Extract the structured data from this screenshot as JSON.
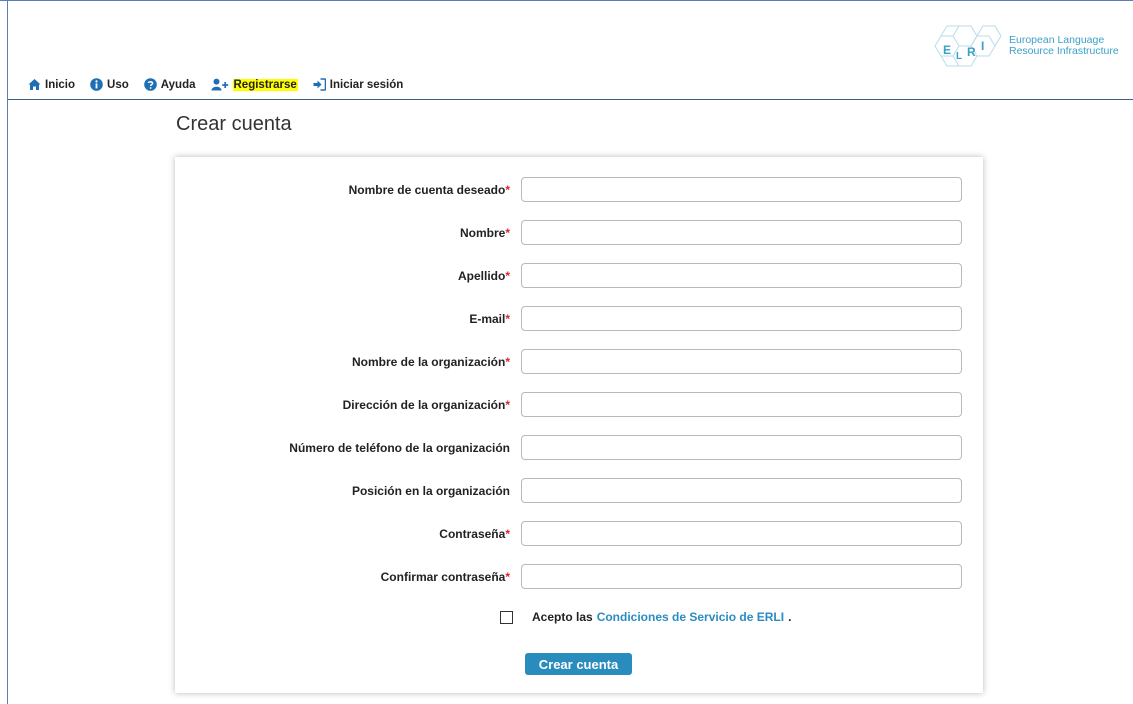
{
  "nav": {
    "items": [
      {
        "label": "Inicio",
        "icon": "home-icon"
      },
      {
        "label": "Uso",
        "icon": "info-icon"
      },
      {
        "label": "Ayuda",
        "icon": "help-icon"
      },
      {
        "label": "Registrarse",
        "icon": "add-user-icon",
        "highlighted": true
      },
      {
        "label": "Iniciar sesión",
        "icon": "sign-in-icon"
      }
    ]
  },
  "logo": {
    "letters": [
      "E",
      "L",
      "R",
      "I"
    ],
    "line1": "European Language",
    "line2": "Resource Infrastructure"
  },
  "page": {
    "title": "Crear cuenta"
  },
  "form": {
    "fields": [
      {
        "label": "Nombre de cuenta deseado",
        "required": "*",
        "value": ""
      },
      {
        "label": "Nombre",
        "required": "*",
        "value": ""
      },
      {
        "label": "Apellido",
        "required": "*",
        "value": ""
      },
      {
        "label": "E-mail",
        "required": "*",
        "value": ""
      },
      {
        "label": "Nombre de la organización",
        "required": "*",
        "value": ""
      },
      {
        "label": "Dirección de la organización",
        "required": "*",
        "value": ""
      },
      {
        "label": "Número de teléfono de la organización",
        "required": "",
        "value": ""
      },
      {
        "label": "Posición en la organización",
        "required": "",
        "value": ""
      },
      {
        "label": "Contraseña",
        "required": "*",
        "value": ""
      },
      {
        "label": "Confirmar contraseña",
        "required": "*",
        "value": ""
      }
    ],
    "terms": {
      "checked": false,
      "prefix": "Acepto las",
      "link": "Condiciones de Servicio de ERLI",
      "suffix": "."
    },
    "submit_label": "Crear cuenta"
  },
  "colors": {
    "accent": "#2a8bbd",
    "link": "#2b8bc2",
    "required": "#d9262c",
    "highlight": "#ffff00",
    "nav_icon": "#1f6fb5",
    "logo": "#3aa0c8"
  }
}
